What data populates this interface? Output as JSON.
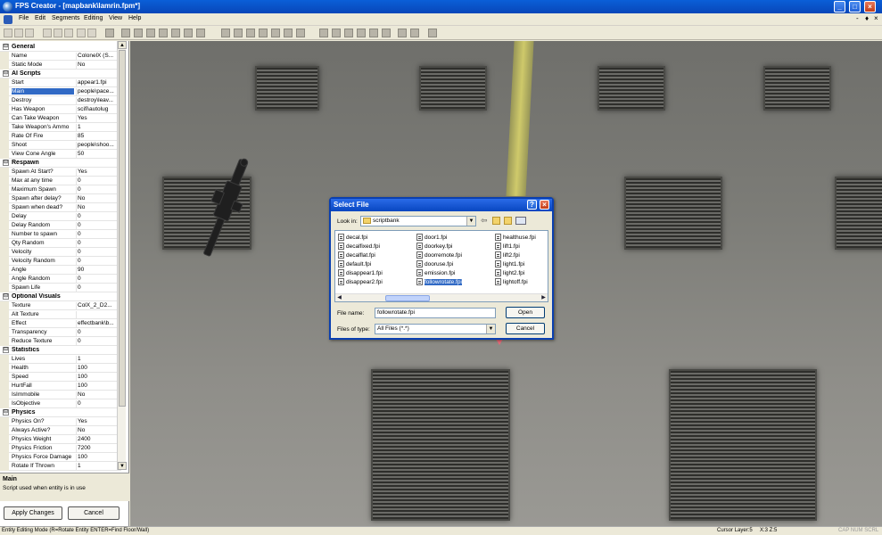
{
  "window": {
    "title": "FPS Creator - [mapbank\\lamrin.fpm*]",
    "controls": [
      "_",
      "□",
      "×"
    ],
    "mdi_controls": [
      "-",
      "♦",
      "×"
    ]
  },
  "menu": [
    "File",
    "Edit",
    "Segments",
    "Editing",
    "View",
    "Help"
  ],
  "properties": [
    {
      "type": "category",
      "label": "General",
      "toggle": "⊟"
    },
    {
      "label": "Name",
      "value": "ColonelX (S..."
    },
    {
      "label": "Static Mode",
      "value": "No"
    },
    {
      "type": "category",
      "label": "AI Scripts",
      "toggle": "⊟"
    },
    {
      "label": "Start",
      "value": "appear1.fpi"
    },
    {
      "label": "Main",
      "value": "people\\pace...",
      "selected": true
    },
    {
      "label": "Destroy",
      "value": "destroy\\leav..."
    },
    {
      "label": "Has Weapon",
      "value": "scifi\\autolug"
    },
    {
      "label": "Can Take Weapon",
      "value": "Yes"
    },
    {
      "label": "Take Weapon's Ammo",
      "value": "1"
    },
    {
      "label": "Rate Of Fire",
      "value": "85"
    },
    {
      "label": "Shoot",
      "value": "people\\shoo..."
    },
    {
      "label": "View Cone Angle",
      "value": "50"
    },
    {
      "type": "category",
      "label": "Respawn",
      "toggle": "⊟"
    },
    {
      "label": "Spawn At Start?",
      "value": "Yes"
    },
    {
      "label": "Max at any time",
      "value": "0"
    },
    {
      "label": "Maximum Spawn",
      "value": "0"
    },
    {
      "label": "Spawn after delay?",
      "value": "No"
    },
    {
      "label": "Spawn when dead?",
      "value": "No"
    },
    {
      "label": "Delay",
      "value": "0"
    },
    {
      "label": "Delay Random",
      "value": "0"
    },
    {
      "label": "Number to spawn",
      "value": "0"
    },
    {
      "label": "Qty Random",
      "value": "0"
    },
    {
      "label": "Velocity",
      "value": "0"
    },
    {
      "label": "Velocity Random",
      "value": "0"
    },
    {
      "label": "Angle",
      "value": "90"
    },
    {
      "label": "Angle Random",
      "value": "0"
    },
    {
      "label": "Spawn Life",
      "value": "0"
    },
    {
      "type": "category",
      "label": "Optional Visuals",
      "toggle": "⊟"
    },
    {
      "label": "Texture",
      "value": "ColX_2_D2..."
    },
    {
      "label": "Alt Texture",
      "value": ""
    },
    {
      "label": "Effect",
      "value": "effectbank\\b..."
    },
    {
      "label": "Transparency",
      "value": "0"
    },
    {
      "label": "Reduce Texture",
      "value": "0"
    },
    {
      "type": "category",
      "label": "Statistics",
      "toggle": "⊟"
    },
    {
      "label": "Lives",
      "value": "1"
    },
    {
      "label": "Health",
      "value": "100"
    },
    {
      "label": "Speed",
      "value": "100"
    },
    {
      "label": "HurtFall",
      "value": "100"
    },
    {
      "label": "IsImmobile",
      "value": "No"
    },
    {
      "label": "IsObjective",
      "value": "0"
    },
    {
      "type": "category",
      "label": "Physics",
      "toggle": "⊟"
    },
    {
      "label": "Physics On?",
      "value": "Yes"
    },
    {
      "label": "Always Active?",
      "value": "No"
    },
    {
      "label": "Physics Weight",
      "value": "2400"
    },
    {
      "label": "Physics Friction",
      "value": "7200"
    },
    {
      "label": "Physics Force Damage",
      "value": "100"
    },
    {
      "label": "Rotate If Thrown",
      "value": "1"
    }
  ],
  "description": {
    "title": "Main",
    "text": "Script used when entity is in use"
  },
  "panel_buttons": {
    "apply": "Apply Changes",
    "cancel": "Cancel"
  },
  "dialog": {
    "title": "Select File",
    "help": "?",
    "close": "×",
    "look_in_label": "Look in:",
    "look_in_value": "scriptbank",
    "files": [
      "decal.fpi",
      "decalfixed.fpi",
      "decalflat.fpi",
      "default.fpi",
      "disappear1.fpi",
      "disappear2.fpi",
      "door1.fpi",
      "doorkey.fpi",
      "doorremote.fpi",
      "dooruse.fpi",
      "emission.fpi",
      "followrotate.fpi",
      "healthuse.fpi",
      "lift1.fpi",
      "lift2.fpi",
      "light1.fpi",
      "light2.fpi",
      "lightoff.fpi"
    ],
    "selected_file": "followrotate.fpi",
    "file_name_label": "File name:",
    "file_name_value": "followrotate.fpi",
    "file_type_label": "Files of type:",
    "file_type_value": "All Files (*.*)",
    "open": "Open",
    "cancel": "Cancel"
  },
  "status": {
    "mode": "Entity Editing Mode (R=Rotate Entity  ENTER=Find Floor/Wall)",
    "cursor": "Cursor Layer:5",
    "xz": "X:3  Z:5",
    "keys": "CAP  NUM  SCRL"
  }
}
